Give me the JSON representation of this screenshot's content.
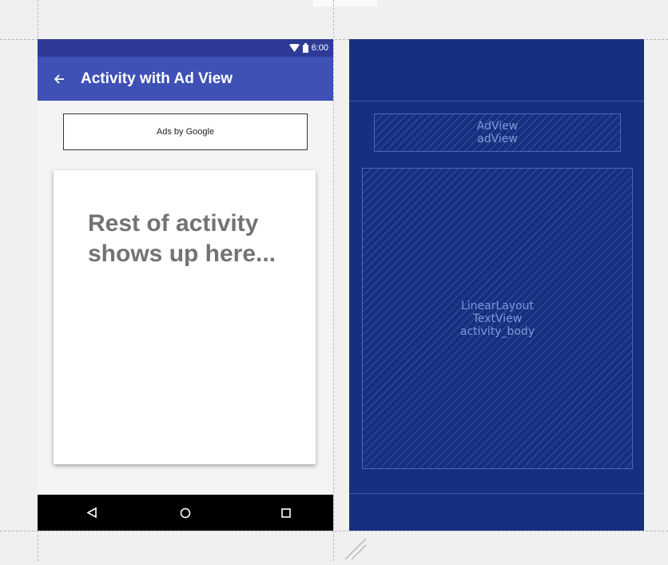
{
  "status_bar": {
    "time": "6:00",
    "icons": [
      "wifi-icon",
      "battery-icon"
    ]
  },
  "app_bar": {
    "title": "Activity with Ad View",
    "back_icon": "back-arrow-icon"
  },
  "ad_view": {
    "label": "Ads by Google"
  },
  "activity_body": {
    "text": "Rest of activity shows up here..."
  },
  "nav_bar": {
    "buttons": [
      "back-triangle-icon",
      "home-circle-icon",
      "recents-square-icon"
    ]
  },
  "blueprint": {
    "ad_view_labels": [
      "AdView",
      "adView"
    ],
    "body_labels": [
      "LinearLayout",
      "TextView",
      "activity_body"
    ]
  },
  "colors": {
    "primary": "#3f51b5",
    "primary_dark": "#2e3a96",
    "blueprint_bg": "#163080",
    "card_text": "#737373"
  }
}
